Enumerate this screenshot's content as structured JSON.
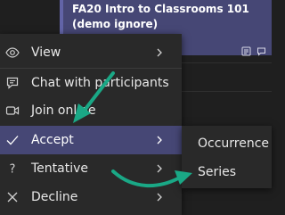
{
  "event": {
    "title": "FA20 Intro to Classrooms 101 (demo ignore)",
    "icons": [
      "recurring-icon",
      "chat-bubble-icon"
    ]
  },
  "menu": {
    "items": [
      {
        "label": "View",
        "icon": "eye-icon",
        "has_submenu": true
      },
      {
        "label": "Chat with participants",
        "icon": "chat-icon",
        "has_submenu": false
      },
      {
        "label": "Join online",
        "icon": "video-camera-icon",
        "has_submenu": false
      },
      {
        "label": "Accept",
        "icon": "checkmark-icon",
        "has_submenu": true,
        "highlighted": true
      },
      {
        "label": "Tentative",
        "icon": "question-mark-icon",
        "has_submenu": true
      },
      {
        "label": "Decline",
        "icon": "x-icon",
        "has_submenu": true
      }
    ]
  },
  "submenu": {
    "items": [
      {
        "label": "Occurrence"
      },
      {
        "label": "Series"
      }
    ]
  },
  "colors": {
    "highlight": "#464775",
    "annotation_arrow": "#1aa886",
    "menu_background": "#292929"
  }
}
